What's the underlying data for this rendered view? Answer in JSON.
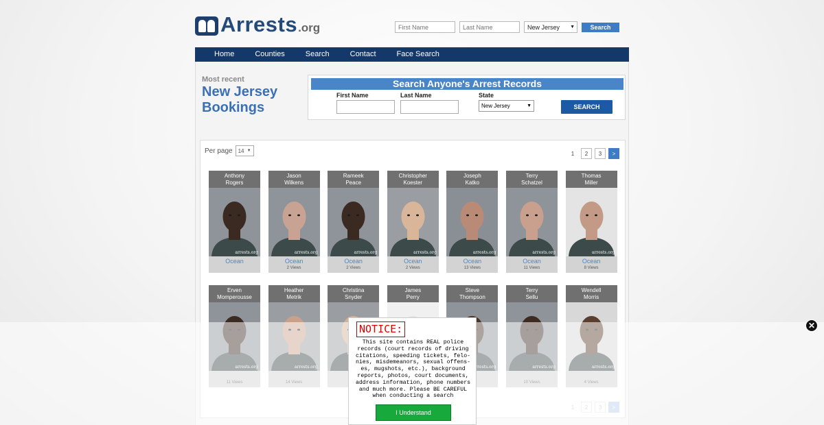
{
  "logo": {
    "text": "Arrests",
    "suffix": ".org"
  },
  "header_search": {
    "first_placeholder": "First Name",
    "last_placeholder": "Last Name",
    "state_value": "New Jersey",
    "button_label": "Search"
  },
  "nav": {
    "items": [
      "Home",
      "Counties",
      "Search",
      "Contact",
      "Face Search"
    ]
  },
  "recent": {
    "small": "Most recent",
    "big": "New Jersey Bookings"
  },
  "search_box": {
    "title": "Search Anyone's Arrest Records",
    "first_label": "First Name",
    "last_label": "Last Name",
    "state_label": "State",
    "state_value": "New Jersey",
    "button_label": "SEARCH"
  },
  "results": {
    "perpage_label": "Per page",
    "perpage_value": "14",
    "pages": [
      "1",
      "2",
      "3",
      ">"
    ],
    "watermark": "arrests.org",
    "cards": [
      {
        "first": "Anthony",
        "last": "Rogers",
        "county": "Ocean",
        "views": ""
      },
      {
        "first": "Jason",
        "last": "Wilkens",
        "county": "Ocean",
        "views": "2 Views"
      },
      {
        "first": "Rameek",
        "last": "Peace",
        "county": "Ocean",
        "views": "2 Views"
      },
      {
        "first": "Christopher",
        "last": "Koester",
        "county": "Ocean",
        "views": "2 Views"
      },
      {
        "first": "Joseph",
        "last": "Katko",
        "county": "Ocean",
        "views": "13 Views"
      },
      {
        "first": "Terry",
        "last": "Schatzel",
        "county": "Ocean",
        "views": "11 Views"
      },
      {
        "first": "Thomas",
        "last": "Miller",
        "county": "Ocean",
        "views": "8 Views"
      },
      {
        "first": "Erven",
        "last": "Momperousse",
        "county": "",
        "views": "11 Views"
      },
      {
        "first": "Heather",
        "last": "Metrik",
        "county": "",
        "views": "14 Views"
      },
      {
        "first": "Christina",
        "last": "Snyder",
        "county": "",
        "views": ""
      },
      {
        "first": "James",
        "last": "Perry",
        "county": "",
        "views": ""
      },
      {
        "first": "Steve",
        "last": "Thompson",
        "county": "",
        "views": ""
      },
      {
        "first": "Terry",
        "last": "Sellu",
        "county": "",
        "views": "10 Views"
      },
      {
        "first": "Wendell",
        "last": "Morris",
        "county": "",
        "views": "4 Views"
      }
    ]
  },
  "notice": {
    "title": "NOTICE:",
    "body": "This site contains REAL police records (court records of driving citations, speeding tickets, felo- nies, misdemeanors, sexual offens- es, mugshots, etc.), background reports, photos, court documents, address information, phone numbers and much more. Please BE CAREFUL when conducting a search",
    "button_label": "I Understand"
  },
  "close_icon": "close-icon",
  "colors": {
    "nav": "#14386a",
    "accent": "#4a86c7",
    "button_green": "#18a93c",
    "notice_red": "#d00000"
  }
}
